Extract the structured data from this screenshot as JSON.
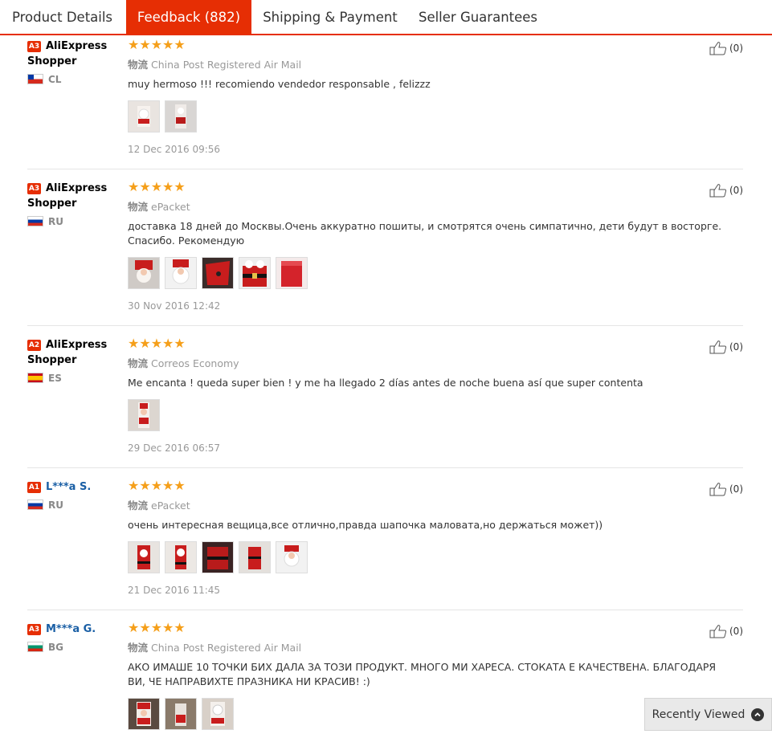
{
  "tabs": [
    {
      "label": "Product Details",
      "active": false
    },
    {
      "label": "Feedback (882)",
      "active": true
    },
    {
      "label": "Shipping & Payment",
      "active": false
    },
    {
      "label": "Seller Guarantees",
      "active": false
    }
  ],
  "accent_color": "#e62e04",
  "star_color": "#f59f1a",
  "reviews": [
    {
      "level": "A3",
      "name_line1": "AliExpress",
      "name_line2": "Shopper",
      "country": "CL",
      "rating": 5,
      "stars": "★★★★★",
      "shipping_label": "物流",
      "shipping": "China Post Registered Air Mail",
      "text": "muy hermoso !!! recomiendo vendedor responsable , felizzz",
      "photos": 2,
      "date": "12 Dec 2016 09:56",
      "likes": "(0)"
    },
    {
      "level": "A3",
      "name_line1": "AliExpress",
      "name_line2": "Shopper",
      "country": "RU",
      "rating": 5,
      "stars": "★★★★★",
      "shipping_label": "物流",
      "shipping": "ePacket",
      "text": "доставка 18 дней до Москвы.Очень аккуратно пошиты, и смотрятся очень симпатично, дети будут в восторге. Спасибо. Рекомендую",
      "photos": 5,
      "date": "30 Nov 2016 12:42",
      "likes": "(0)"
    },
    {
      "level": "A2",
      "name_line1": "AliExpress",
      "name_line2": "Shopper",
      "country": "ES",
      "rating": 5,
      "stars": "★★★★★",
      "shipping_label": "物流",
      "shipping": "Correos Economy",
      "text": "Me encanta ! queda super bien ! y me ha llegado 2 días antes de noche buena así que super contenta",
      "photos": 1,
      "date": "29 Dec 2016 06:57",
      "likes": "(0)"
    },
    {
      "level": "A1",
      "name_line1": "L***a S.",
      "country": "RU",
      "rating": 5,
      "stars": "★★★★★",
      "shipping_label": "物流",
      "shipping": "ePacket",
      "text": "очень интересная вещица,все отлично,правда шапочка маловата,но держаться может))",
      "photos": 5,
      "date": "21 Dec 2016 11:45",
      "likes": "(0)"
    },
    {
      "level": "A3",
      "name_line1": "M***a G.",
      "country": "BG",
      "rating": 5,
      "stars": "★★★★★",
      "shipping_label": "物流",
      "shipping": "China Post Registered Air Mail",
      "text": "АКО ИМАШЕ 10 ТОЧКИ БИХ ДАЛА ЗА ТОЗИ ПРОДУКТ. МНОГО МИ ХАРЕСА. СТОКАТА Е КАЧЕСТВЕНА. БЛАГОДАРЯ ВИ, ЧЕ НАПРАВИХТЕ ПРАЗНИКА НИ КРАСИВ! :)",
      "photos": 3,
      "date": "",
      "likes": "(0)"
    }
  ],
  "recently_viewed": {
    "label": "Recently Viewed",
    "icon": "chevron-up-icon"
  }
}
